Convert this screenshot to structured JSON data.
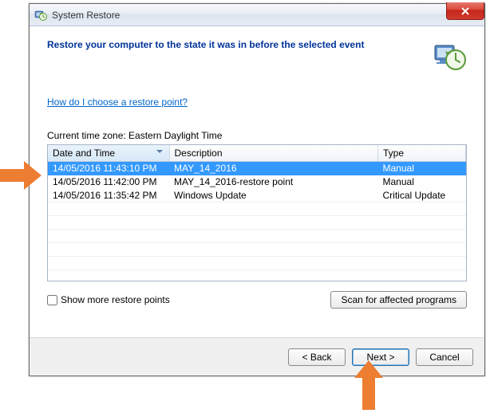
{
  "window": {
    "title": "System Restore"
  },
  "heading": "Restore your computer to the state it was in before the selected event",
  "help_link": "How do I choose a restore point?",
  "timezone_label": "Current time zone: Eastern Daylight Time",
  "columns": {
    "datetime": "Date and Time",
    "description": "Description",
    "type": "Type"
  },
  "rows": [
    {
      "datetime": "14/05/2016 11:43:10 PM",
      "description": "MAY_14_2016",
      "type": "Manual",
      "selected": true
    },
    {
      "datetime": "14/05/2016 11:42:00 PM",
      "description": "MAY_14_2016-restore point",
      "type": "Manual",
      "selected": false
    },
    {
      "datetime": "14/05/2016 11:35:42 PM",
      "description": "Windows Update",
      "type": "Critical Update",
      "selected": false
    }
  ],
  "show_more_label": "Show more restore points",
  "scan_button": "Scan for affected programs",
  "buttons": {
    "back": "< Back",
    "next": "Next >",
    "cancel": "Cancel"
  }
}
